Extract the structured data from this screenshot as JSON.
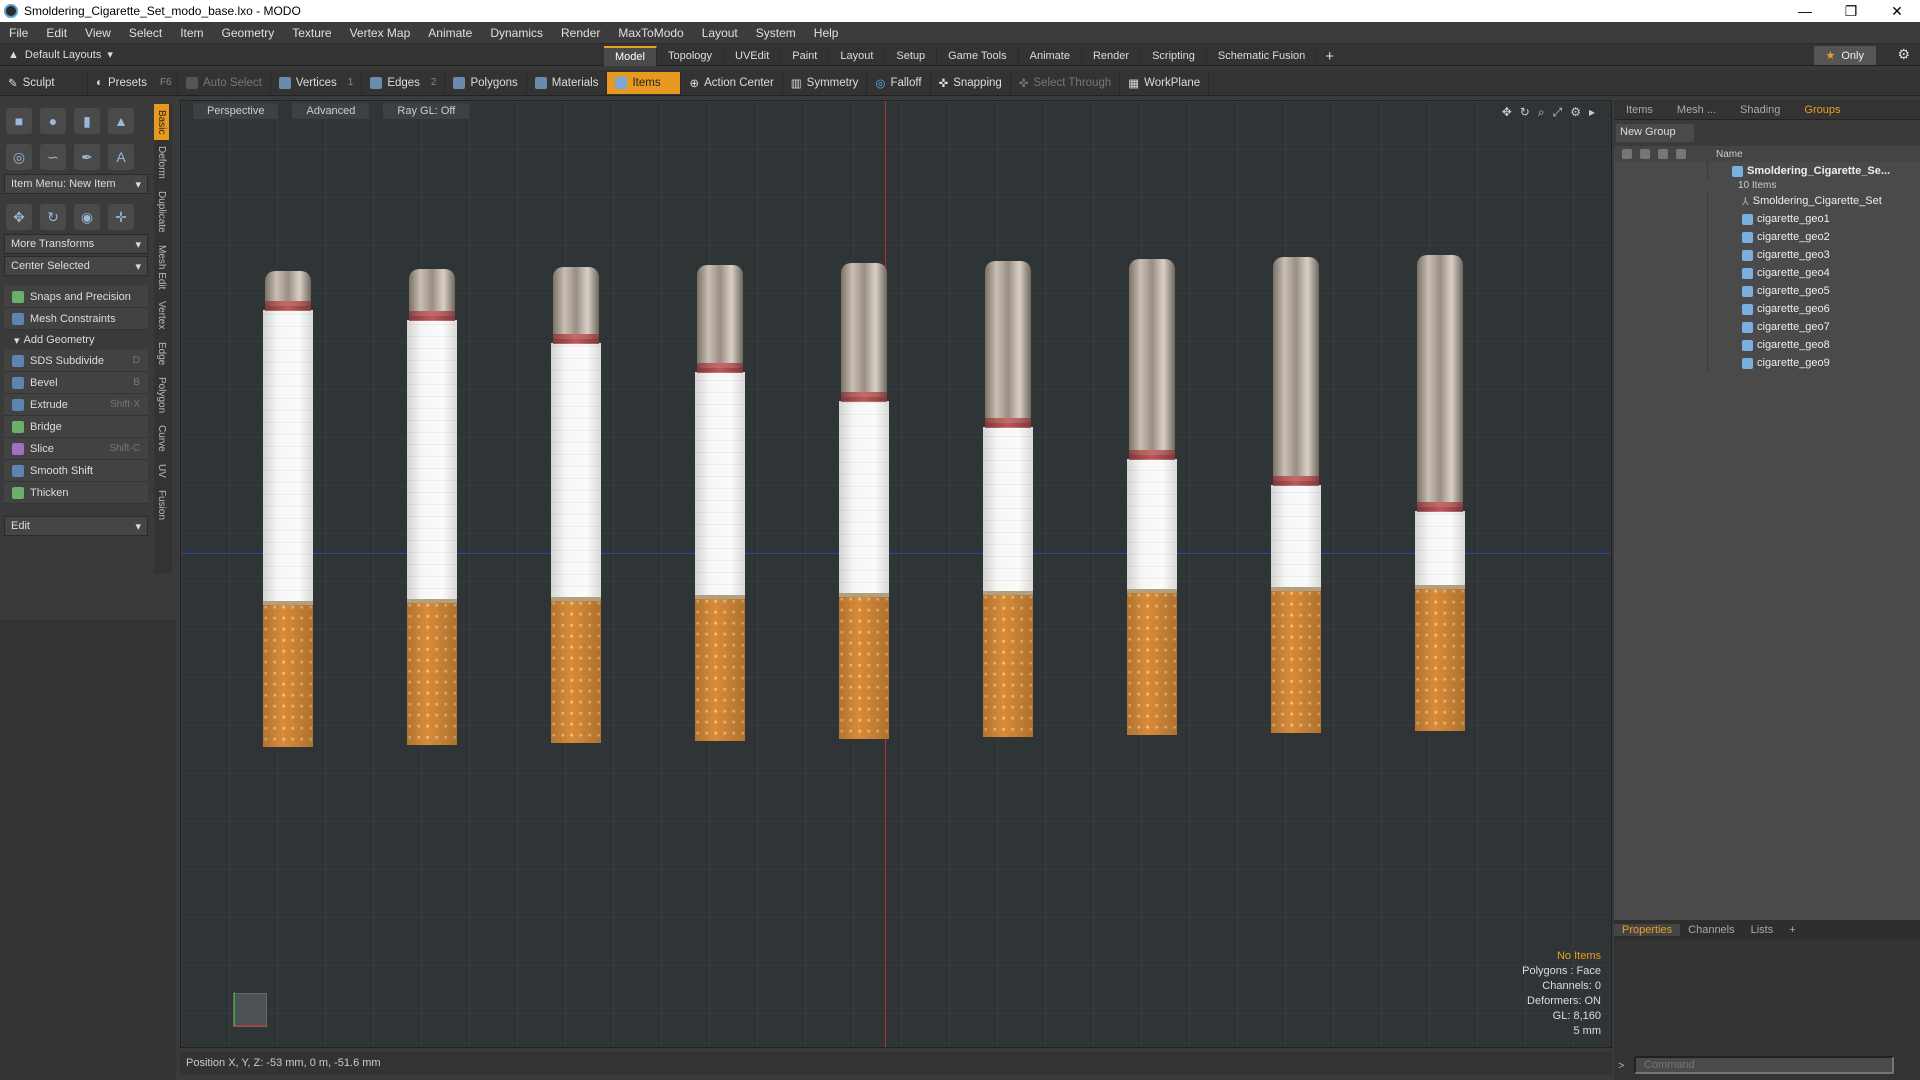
{
  "window": {
    "title": "Smoldering_Cigarette_Set_modo_base.lxo - MODO"
  },
  "menu": [
    "File",
    "Edit",
    "View",
    "Select",
    "Item",
    "Geometry",
    "Texture",
    "Vertex Map",
    "Animate",
    "Dynamics",
    "Render",
    "MaxToModo",
    "Layout",
    "System",
    "Help"
  ],
  "layout": {
    "default_layouts": "Default Layouts",
    "tabs": [
      "Model",
      "Topology",
      "UVEdit",
      "Paint",
      "Layout",
      "Setup",
      "Game Tools",
      "Animate",
      "Render",
      "Scripting",
      "Schematic Fusion"
    ],
    "active_tab": "Model",
    "only_label": "Only"
  },
  "toolbar": {
    "sculpt": "Sculpt",
    "presets": "Presets",
    "presets_hotkey": "F6",
    "auto_select": "Auto Select",
    "vertices": "Vertices",
    "vertices_num": "1",
    "edges": "Edges",
    "edges_num": "2",
    "polygons": "Polygons",
    "materials": "Materials",
    "items": "Items",
    "action_center": "Action Center",
    "symmetry": "Symmetry",
    "falloff": "Falloff",
    "snapping": "Snapping",
    "select_through": "Select Through",
    "workplane": "WorkPlane"
  },
  "left_panel": {
    "item_menu": "Item Menu: New Item",
    "more_transforms": "More Transforms",
    "center_selected": "Center Selected",
    "snaps": "Snaps and Precision",
    "mesh_constraints": "Mesh Constraints",
    "add_geometry": "Add Geometry",
    "tools": [
      {
        "label": "SDS Subdivide",
        "hotkey": "D"
      },
      {
        "label": "Bevel",
        "hotkey": "B"
      },
      {
        "label": "Extrude",
        "hotkey": "Shift-X"
      },
      {
        "label": "Bridge",
        "hotkey": ""
      },
      {
        "label": "Slice",
        "hotkey": "Shift-C"
      },
      {
        "label": "Smooth Shift",
        "hotkey": ""
      },
      {
        "label": "Thicken",
        "hotkey": ""
      }
    ],
    "edit": "Edit",
    "vtabs": [
      "Basic",
      "Deform",
      "Duplicate",
      "Mesh Edit",
      "Vertex",
      "Edge",
      "Polygon",
      "Curve",
      "UV",
      "Fusion"
    ]
  },
  "viewport": {
    "perspective": "Perspective",
    "advanced": "Advanced",
    "raygl": "Ray GL: Off",
    "info": {
      "no_items": "No Items",
      "polygons": "Polygons : Face",
      "channels": "Channels: 0",
      "deformers": "Deformers: ON",
      "gl": "GL: 8,160",
      "scale": "5 mm"
    },
    "cigarettes": [
      {
        "ash": 0.06,
        "burn": 1
      },
      {
        "ash": 0.1,
        "burn": 2
      },
      {
        "ash": 0.18,
        "burn": 3
      },
      {
        "ash": 0.28,
        "burn": 4
      },
      {
        "ash": 0.38,
        "burn": 5
      },
      {
        "ash": 0.47,
        "burn": 6
      },
      {
        "ash": 0.58,
        "burn": 7
      },
      {
        "ash": 0.67,
        "burn": 8
      },
      {
        "ash": 0.76,
        "burn": 9
      }
    ]
  },
  "status": {
    "position": "Position X, Y, Z:   -53 mm, 0 m, -51.6 mm"
  },
  "right_panel": {
    "tabs": [
      "Items",
      "Mesh ...",
      "Shading",
      "Groups"
    ],
    "active_tab": "Groups",
    "new_group": "New Group",
    "name_col": "Name",
    "root": "Smoldering_Cigarette_Se...",
    "root_sub": "10 Items",
    "children": [
      "Smoldering_Cigarette_Set",
      "cigarette_geo1",
      "cigarette_geo2",
      "cigarette_geo3",
      "cigarette_geo4",
      "cigarette_geo5",
      "cigarette_geo6",
      "cigarette_geo7",
      "cigarette_geo8",
      "cigarette_geo9"
    ]
  },
  "prop_panel": {
    "tabs": [
      "Properties",
      "Channels",
      "Lists"
    ],
    "active_tab": "Properties",
    "command_placeholder": "Command"
  }
}
